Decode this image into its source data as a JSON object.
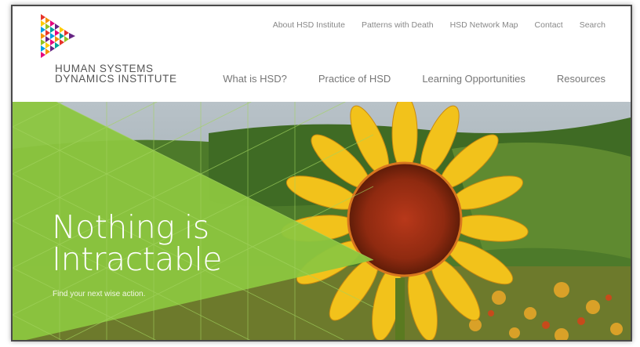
{
  "brand": {
    "logo_line1": "HUMAN SYSTEMS",
    "logo_line2": "DYNAMICS INSTITUTE",
    "colors": {
      "green": "#8cc63f",
      "text": "#555555"
    }
  },
  "top_nav": [
    {
      "label": "About HSD Institute"
    },
    {
      "label": "Patterns with Death"
    },
    {
      "label": "HSD Network Map"
    },
    {
      "label": "Contact"
    },
    {
      "label": "Search"
    }
  ],
  "main_nav": [
    {
      "label": "What is HSD?"
    },
    {
      "label": "Practice of HSD"
    },
    {
      "label": "Learning Opportunities"
    },
    {
      "label": "Resources"
    }
  ],
  "hero": {
    "title_line1": "Nothing is",
    "title_line2": "Intractable",
    "subtitle": "Find your next wise action.",
    "image": "sunflower-painting"
  }
}
